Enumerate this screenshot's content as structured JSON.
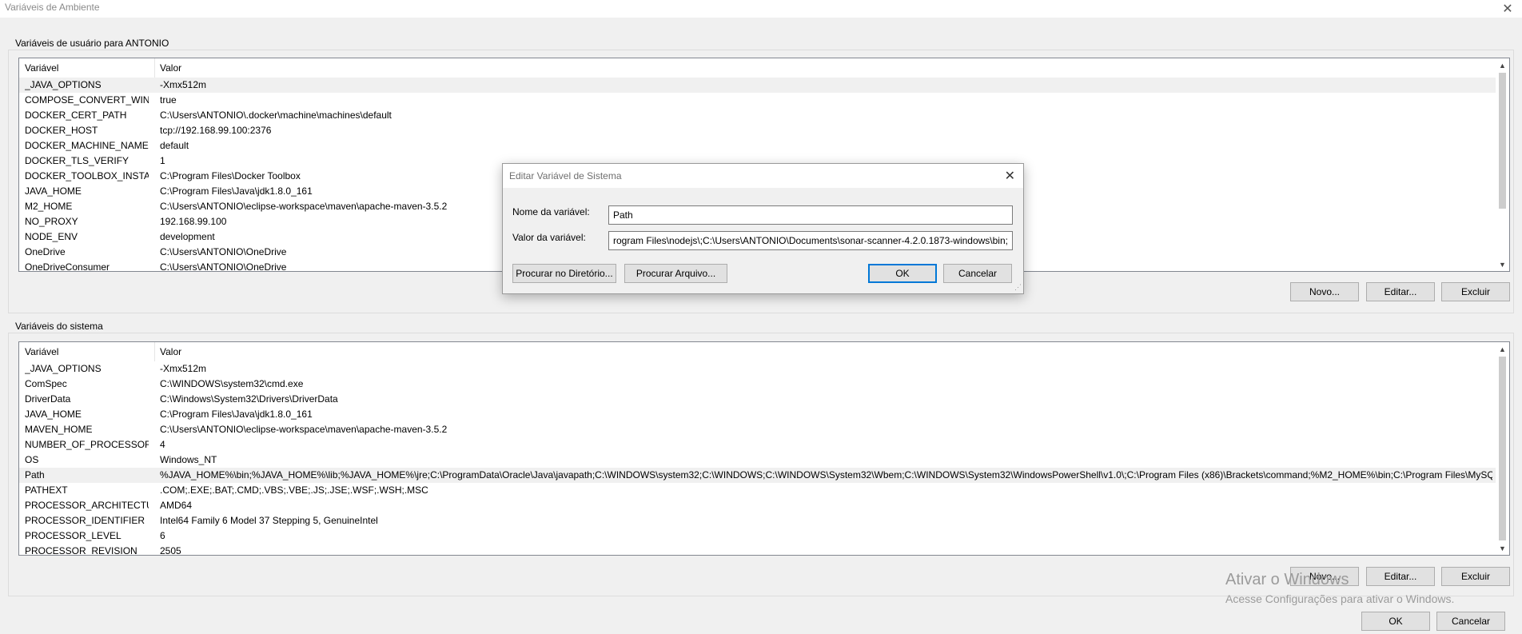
{
  "window": {
    "title": "Variáveis de Ambiente",
    "close_glyph": "✕"
  },
  "user_section": {
    "label": "Variáveis de usuário para ANTONIO",
    "columns": [
      "Variável",
      "Valor"
    ],
    "rows": [
      {
        "name": "_JAVA_OPTIONS",
        "value": "-Xmx512m"
      },
      {
        "name": "COMPOSE_CONVERT_WIND...",
        "value": "true"
      },
      {
        "name": "DOCKER_CERT_PATH",
        "value": "C:\\Users\\ANTONIO\\.docker\\machine\\machines\\default"
      },
      {
        "name": "DOCKER_HOST",
        "value": "tcp://192.168.99.100:2376"
      },
      {
        "name": "DOCKER_MACHINE_NAME",
        "value": "default"
      },
      {
        "name": "DOCKER_TLS_VERIFY",
        "value": "1"
      },
      {
        "name": "DOCKER_TOOLBOX_INSTALL...",
        "value": "C:\\Program Files\\Docker Toolbox"
      },
      {
        "name": "JAVA_HOME",
        "value": "C:\\Program Files\\Java\\jdk1.8.0_161"
      },
      {
        "name": "M2_HOME",
        "value": "C:\\Users\\ANTONIO\\eclipse-workspace\\maven\\apache-maven-3.5.2"
      },
      {
        "name": "NO_PROXY",
        "value": "192.168.99.100"
      },
      {
        "name": "NODE_ENV",
        "value": "development"
      },
      {
        "name": "OneDrive",
        "value": "C:\\Users\\ANTONIO\\OneDrive"
      },
      {
        "name": "OneDriveConsumer",
        "value": "C:\\Users\\ANTONIO\\OneDrive"
      }
    ],
    "buttons": {
      "new": "Novo...",
      "edit": "Editar...",
      "delete": "Excluir"
    }
  },
  "system_section": {
    "label": "Variáveis do sistema",
    "columns": [
      "Variável",
      "Valor"
    ],
    "rows": [
      {
        "name": "_JAVA_OPTIONS",
        "value": "-Xmx512m"
      },
      {
        "name": "ComSpec",
        "value": "C:\\WINDOWS\\system32\\cmd.exe"
      },
      {
        "name": "DriverData",
        "value": "C:\\Windows\\System32\\Drivers\\DriverData"
      },
      {
        "name": "JAVA_HOME",
        "value": "C:\\Program Files\\Java\\jdk1.8.0_161"
      },
      {
        "name": "MAVEN_HOME",
        "value": "C:\\Users\\ANTONIO\\eclipse-workspace\\maven\\apache-maven-3.5.2"
      },
      {
        "name": "NUMBER_OF_PROCESSORS",
        "value": "4"
      },
      {
        "name": "OS",
        "value": "Windows_NT"
      },
      {
        "name": "Path",
        "value": "%JAVA_HOME%\\bin;%JAVA_HOME%\\lib;%JAVA_HOME%\\jre;C:\\ProgramData\\Oracle\\Java\\javapath;C:\\WINDOWS\\system32;C:\\WINDOWS;C:\\WINDOWS\\System32\\Wbem;C:\\WINDOWS\\System32\\WindowsPowerShell\\v1.0\\;C:\\Program Files (x86)\\Brackets\\command;%M2_HOME%\\bin;C:\\Program Files\\MySQ"
      },
      {
        "name": "PATHEXT",
        "value": ".COM;.EXE;.BAT;.CMD;.VBS;.VBE;.JS;.JSE;.WSF;.WSH;.MSC"
      },
      {
        "name": "PROCESSOR_ARCHITECTURE",
        "value": "AMD64"
      },
      {
        "name": "PROCESSOR_IDENTIFIER",
        "value": "Intel64 Family 6 Model 37 Stepping 5, GenuineIntel"
      },
      {
        "name": "PROCESSOR_LEVEL",
        "value": "6"
      },
      {
        "name": "PROCESSOR_REVISION",
        "value": "2505"
      }
    ],
    "buttons": {
      "new": "Novo...",
      "edit": "Editar...",
      "delete": "Excluir"
    }
  },
  "footer": {
    "ok": "OK",
    "cancel": "Cancelar"
  },
  "dialog": {
    "title": "Editar Variável de Sistema",
    "name_label": "Nome da variável:",
    "name_value": "Path",
    "value_label": "Valor da variável:",
    "value_value": "rogram Files\\nodejs\\;C:\\Users\\ANTONIO\\Documents\\sonar-scanner-4.2.0.1873-windows\\bin;",
    "browse_dir": "Procurar no Diretório...",
    "browse_file": "Procurar Arquivo...",
    "ok": "OK",
    "cancel": "Cancelar"
  },
  "watermark": {
    "line1": "Ativar o Windows",
    "line2": "Acesse Configurações para ativar o Windows."
  }
}
